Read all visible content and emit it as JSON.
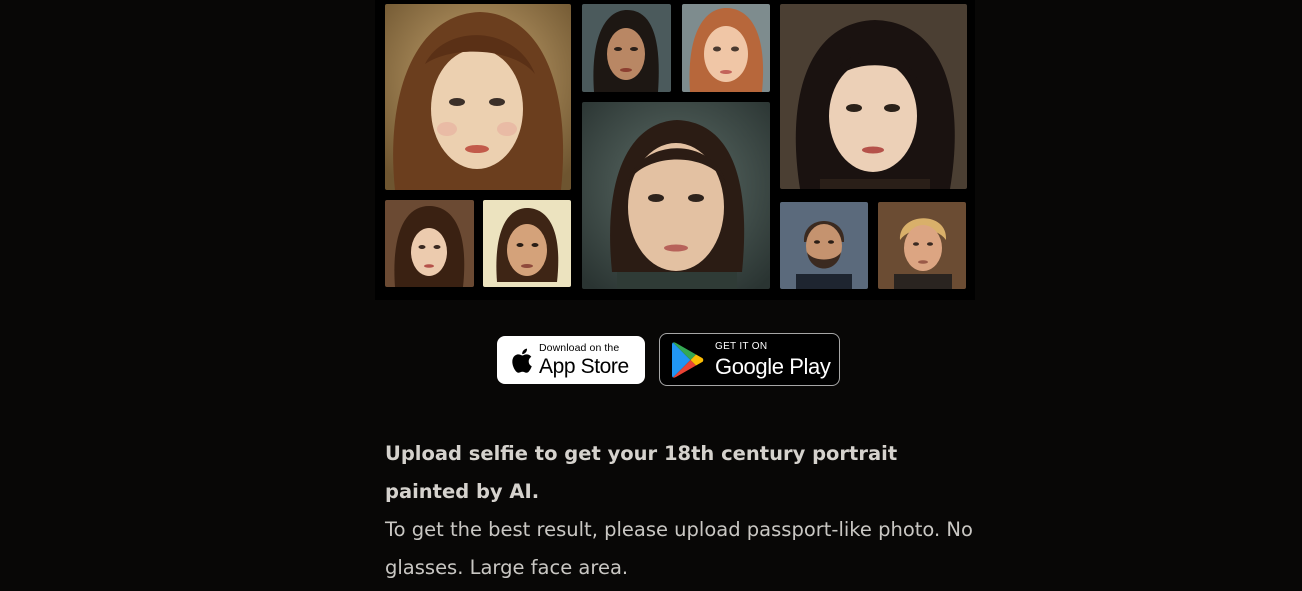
{
  "gallery": {
    "portraits": [
      {
        "name": "portrait-woman-auburn"
      },
      {
        "name": "portrait-woman-dark-small"
      },
      {
        "name": "portrait-girl-redhead"
      },
      {
        "name": "portrait-woman-black-hair"
      },
      {
        "name": "portrait-girl-center"
      },
      {
        "name": "portrait-woman-brunette-small"
      },
      {
        "name": "portrait-woman-bob"
      },
      {
        "name": "portrait-man-bearded"
      },
      {
        "name": "portrait-man-blond"
      }
    ]
  },
  "badges": {
    "app_store": {
      "small": "Download on the",
      "big": "App Store",
      "icon": "apple-icon"
    },
    "google_play": {
      "small": "GET IT ON",
      "big": "Google Play",
      "icon": "google-play-icon"
    }
  },
  "content": {
    "headline": "Upload selfie to get your 18th century portrait painted by AI.",
    "body": "To get the best result, please upload passport-like photo. No glasses. Large face area."
  },
  "colors": {
    "background": "#080706",
    "text": "#c9c7c3"
  }
}
